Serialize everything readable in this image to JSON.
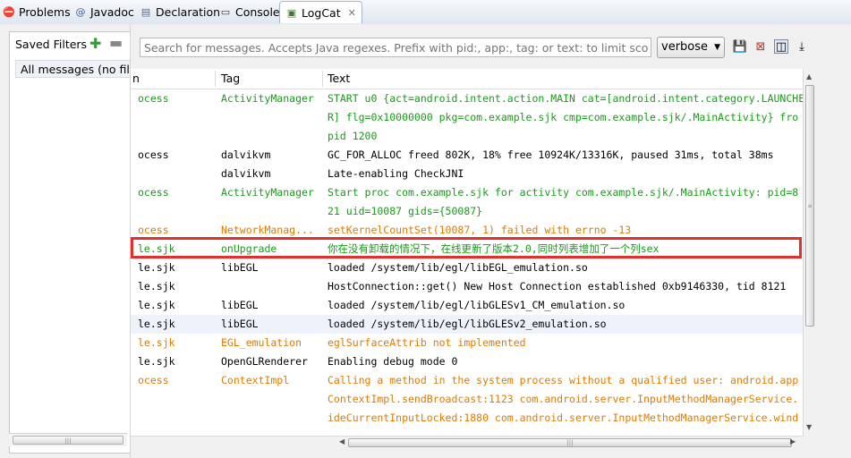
{
  "tabs": [
    {
      "label": "Problems",
      "icon": "problems-icon",
      "glyph": "⛔"
    },
    {
      "label": "Javadoc",
      "icon": "at-icon",
      "glyph": "@"
    },
    {
      "label": "Declaration",
      "icon": "declaration-icon",
      "glyph": "▤"
    },
    {
      "label": "Console",
      "icon": "console-icon",
      "glyph": "▭"
    },
    {
      "label": "LogCat",
      "icon": "logcat-icon",
      "glyph": "▣",
      "active": true,
      "close": "✕"
    }
  ],
  "filters": {
    "title": "Saved Filters",
    "add_glyph": "✚",
    "remove_glyph": "▬",
    "items": [
      "All messages (no filters)"
    ]
  },
  "search": {
    "placeholder": "Search for messages. Accepts Java regexes. Prefix with pid:, app:, tag: or text: to limit scope."
  },
  "level": {
    "value": "verbose",
    "arrow": "▼"
  },
  "toolbar": {
    "save_glyph": "💾",
    "clear_glyph": "⊠",
    "toggle_glyph": "◫",
    "scroll_glyph": "⤓"
  },
  "table": {
    "headers": {
      "app": "n",
      "tag": "Tag",
      "text": "Text"
    },
    "rows": [
      {
        "app": "ocess",
        "tag": "ActivityManager",
        "text": "START u0 {act=android.intent.action.MAIN cat=[android.intent.category.LAUNCHER]",
        "color": "green"
      },
      {
        "app": "",
        "tag": "",
        "text": "R] flg=0x10000000 pkg=com.example.sjk cmp=com.example.sjk/.MainActivity} fro",
        "color": "green"
      },
      {
        "app": "",
        "tag": "",
        "text": " pid 1200",
        "color": "green"
      },
      {
        "app": "ocess",
        "tag": "dalvikvm",
        "text": "GC_FOR_ALLOC freed 802K, 18% free 10924K/13316K, paused 31ms, total 38ms",
        "color": "blackc"
      },
      {
        "app": "",
        "tag": "dalvikvm",
        "text": "Late-enabling CheckJNI",
        "color": "blackc"
      },
      {
        "app": "ocess",
        "tag": "ActivityManager",
        "text": "Start proc com.example.sjk for activity com.example.sjk/.MainActivity: pid=8",
        "color": "green"
      },
      {
        "app": "",
        "tag": "",
        "text": "21 uid=10087 gids={50087}",
        "color": "green"
      },
      {
        "app": "ocess",
        "tag": "NetworkManag...",
        "text": "setKernelCountSet(10087, 1) failed with errno -13",
        "color": "orange"
      },
      {
        "app": "le.sjk",
        "tag": "onUpgrade",
        "text": "你在没有卸载的情况下，在线更新了版本2.0,同时列表增加了一个列sex",
        "color": "green"
      },
      {
        "app": "le.sjk",
        "tag": "libEGL",
        "text": "loaded /system/lib/egl/libEGL_emulation.so",
        "color": "blackc"
      },
      {
        "app": "le.sjk",
        "tag": "",
        "text": "HostConnection::get() New Host Connection established 0xb9146330, tid 8121",
        "color": "blackc"
      },
      {
        "app": "le.sjk",
        "tag": "libEGL",
        "text": "loaded /system/lib/egl/libGLESv1_CM_emulation.so",
        "color": "blackc"
      },
      {
        "app": "le.sjk",
        "tag": "libEGL",
        "text": "loaded /system/lib/egl/libGLESv2_emulation.so",
        "color": "blackc",
        "selected": true
      },
      {
        "app": "le.sjk",
        "tag": "EGL_emulation",
        "text": "eglSurfaceAttrib not implemented",
        "color": "orange"
      },
      {
        "app": "le.sjk",
        "tag": "OpenGLRenderer",
        "text": "Enabling debug mode 0",
        "color": "blackc"
      },
      {
        "app": "ocess",
        "tag": "ContextImpl",
        "text": "Calling a method in the system process without a qualified user: android.app",
        "color": "orange"
      },
      {
        "app": "",
        "tag": "",
        "text": "ContextImpl.sendBroadcast:1123 com.android.server.InputMethodManagerService.",
        "color": "orange"
      },
      {
        "app": "",
        "tag": "",
        "text": "ideCurrentInputLocked:1880 com.android.server.InputMethodManagerService.wind",
        "color": "orange"
      }
    ]
  },
  "colors": {
    "green": "#1a9a1a",
    "orange": "#e07a00",
    "highlight": "#e03030"
  }
}
